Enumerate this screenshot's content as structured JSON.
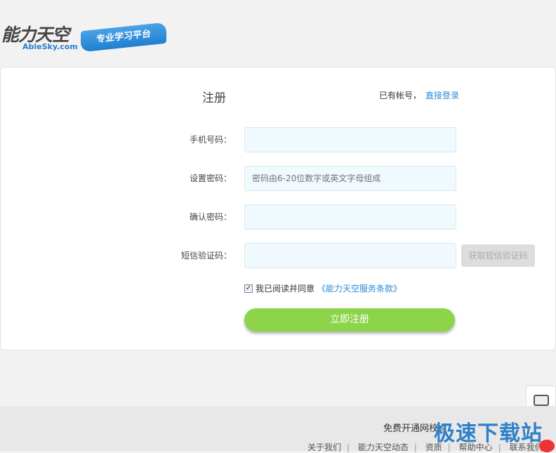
{
  "logo": {
    "cn": "能力天空",
    "en": "AbleSky.com",
    "ribbon": "专业学习平台"
  },
  "form": {
    "title": "注册",
    "has_account": "已有帐号，",
    "login_link": "直接登录",
    "fields": [
      {
        "label": "手机号码：",
        "value": "",
        "placeholder": ""
      },
      {
        "label": "设置密码：",
        "value": "",
        "placeholder": "密码由6-20位数字或英文字母组成"
      },
      {
        "label": "确认密码：",
        "value": "",
        "placeholder": ""
      },
      {
        "label": "短信验证码：",
        "value": "",
        "placeholder": ""
      }
    ],
    "sms_button": "获取短信验证码",
    "agree_checked": true,
    "agree_text": "我已阅读并同意",
    "terms_link": "《能力天空服务条款》",
    "submit": "立即注册"
  },
  "footer": {
    "line1": "免费开通网校◎",
    "links": [
      "关于我们",
      "能力天空动态",
      "资质",
      "帮助中心",
      "联系我们"
    ],
    "separator": "|"
  },
  "watermark": "极速下载站",
  "colors": {
    "accent": "#2b8ad6",
    "submit": "#8cd44a",
    "input_bg": "#f0f9fd"
  }
}
